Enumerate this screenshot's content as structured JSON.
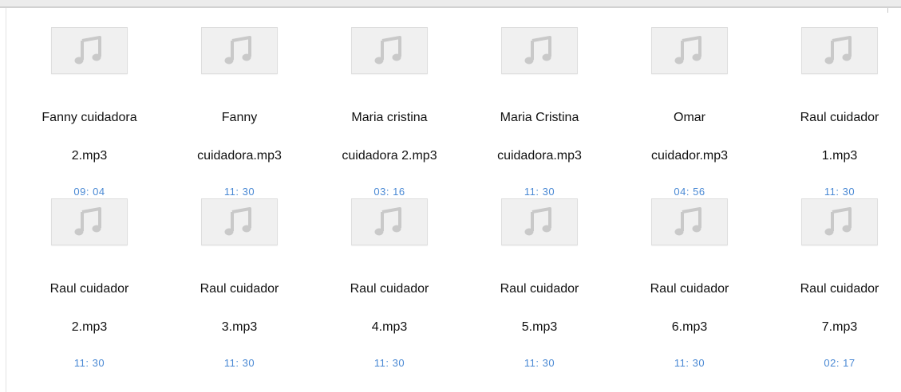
{
  "files": [
    {
      "name_line1": "Fanny cuidadora",
      "name_line2": "2.mp3",
      "duration": "09: 04",
      "icon": "music-note-icon"
    },
    {
      "name_line1": "Fanny",
      "name_line2": "cuidadora.mp3",
      "duration": "11: 30",
      "icon": "music-note-icon"
    },
    {
      "name_line1": "Maria cristina",
      "name_line2": "cuidadora 2.mp3",
      "duration": "03: 16",
      "icon": "music-note-icon"
    },
    {
      "name_line1": "Maria Cristina",
      "name_line2": "cuidadora.mp3",
      "duration": "11: 30",
      "icon": "music-note-icon"
    },
    {
      "name_line1": "Omar",
      "name_line2": "cuidador.mp3",
      "duration": "04: 56",
      "icon": "music-note-icon"
    },
    {
      "name_line1": "Raul cuidador",
      "name_line2": "1.mp3",
      "duration": "11: 30",
      "icon": "music-note-icon"
    },
    {
      "name_line1": "Raul cuidador",
      "name_line2": "2.mp3",
      "duration": "11: 30",
      "icon": "music-note-icon"
    },
    {
      "name_line1": "Raul cuidador",
      "name_line2": "3.mp3",
      "duration": "11: 30",
      "icon": "music-note-icon"
    },
    {
      "name_line1": "Raul cuidador",
      "name_line2": "4.mp3",
      "duration": "11: 30",
      "icon": "music-note-icon"
    },
    {
      "name_line1": "Raul cuidador",
      "name_line2": "5.mp3",
      "duration": "11: 30",
      "icon": "music-note-icon"
    },
    {
      "name_line1": "Raul cuidador",
      "name_line2": "6.mp3",
      "duration": "11: 30",
      "icon": "music-note-icon"
    },
    {
      "name_line1": "Raul cuidador",
      "name_line2": "7.mp3",
      "duration": "02: 17",
      "icon": "music-note-icon"
    }
  ],
  "colors": {
    "duration_text": "#4a89d4",
    "icon_glyph": "#c9c9c9",
    "thumb_bg": "#f0f0f0"
  }
}
